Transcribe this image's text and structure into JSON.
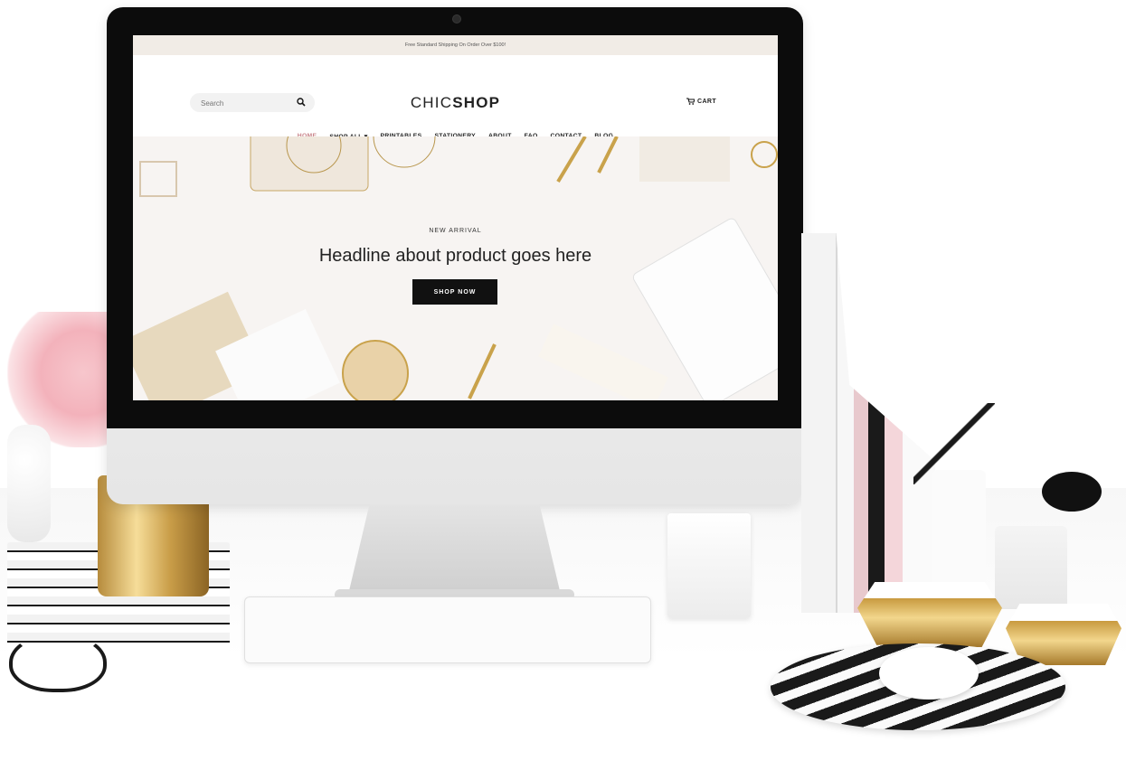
{
  "topbar": {
    "promo": "Free Standard Shipping On Order Over $100!"
  },
  "header": {
    "search_placeholder": "Search",
    "logo_thin": "CHIC",
    "logo_bold": "SHOP",
    "cart_label": "CART"
  },
  "nav": {
    "items": [
      {
        "label": "HOME",
        "active": true
      },
      {
        "label": "SHOP ALL ▾"
      },
      {
        "label": "PRINTABLES"
      },
      {
        "label": "STATIONERY"
      },
      {
        "label": "ABOUT"
      },
      {
        "label": "FAQ"
      },
      {
        "label": "CONTACT"
      },
      {
        "label": "BLOG"
      }
    ]
  },
  "hero": {
    "label": "NEW ARRIVAL",
    "headline": "Headline about product goes here",
    "button": "SHOP NOW"
  },
  "colors": {
    "accent": "#c9848a",
    "button_bg": "#111111",
    "topbar_bg": "#f1ece6"
  },
  "icons": {
    "search": "search-icon",
    "cart": "cart-icon"
  }
}
